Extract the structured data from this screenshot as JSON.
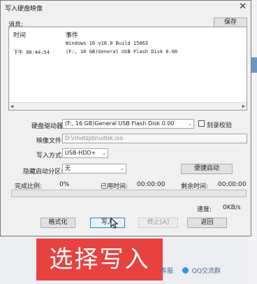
{
  "window": {
    "title": "写入硬盘映像"
  },
  "message_section": {
    "label": "消息:",
    "save_label": "保存"
  },
  "log": {
    "col_time": "时间",
    "col_event": "事件",
    "rows": [
      {
        "time": "",
        "event": "Windows 10 v10.0 Build 15063"
      },
      {
        "time": "下午 08:44:54",
        "event": "(F:, 16 GB)General USB Flash Disk  0.00"
      }
    ]
  },
  "drive": {
    "label": "硬盘驱动器:",
    "value": "(F:, 16 GB)General USB Flash Disk  0.00",
    "verify_label": "刻录校验"
  },
  "image_file": {
    "label": "映像文件:",
    "value": "D:\\nhotzjds\\udisk.iso"
  },
  "write_method": {
    "label": "写入方式:",
    "value": "USB-HDD+"
  },
  "hidden_partition": {
    "label": "隐藏启动分区:",
    "value": "无",
    "boot_button_label": "便捷启动"
  },
  "status": {
    "done_label": "完成比例:",
    "done_value": "0%",
    "elapsed_label": "已用时间:",
    "elapsed_value": "00:00:00",
    "remaining_label": "剩余时间:",
    "remaining_value": "00:00:00",
    "progress_fraction": 0,
    "speed_label": "速度:",
    "speed_value": "0KB/s"
  },
  "buttons": {
    "format": "格式化",
    "write": "写入",
    "stop": "终止[A]",
    "back": "返回"
  },
  "overlay": {
    "banner_text": "选择写入"
  },
  "taskbar": {
    "left_text": "客服",
    "qq_text": "QQ交流群"
  },
  "colors": {
    "banner": "#e8423f",
    "progress": "#06b025",
    "focus": "#3c7fb1"
  }
}
